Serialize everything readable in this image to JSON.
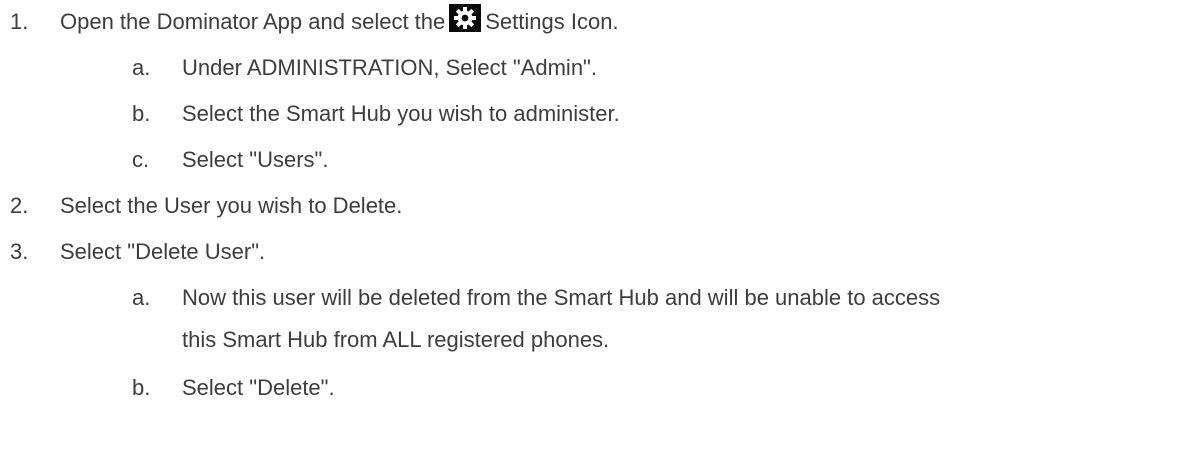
{
  "steps": [
    {
      "marker": "1.",
      "text_before": "Open the Dominator App and select the",
      "icon": "gear-icon",
      "text_after": "Settings Icon.",
      "substeps": [
        {
          "marker": "a.",
          "text": "Under ADMINISTRATION, Select \"Admin\"."
        },
        {
          "marker": "b.",
          "text": "Select the Smart Hub you wish to administer."
        },
        {
          "marker": "c.",
          "text": "Select \"Users\"."
        }
      ]
    },
    {
      "marker": "2.",
      "text": "Select the User you wish to Delete."
    },
    {
      "marker": "3.",
      "text": "Select \"Delete User\".",
      "substeps": [
        {
          "marker": "a.",
          "text_line1": "Now this user will be deleted from the Smart Hub and will be unable to access",
          "text_line2": "this Smart Hub from ALL registered phones."
        },
        {
          "marker": "b.",
          "text": "Select \"Delete\"."
        }
      ]
    }
  ],
  "colors": {
    "text": "#3d3d3d",
    "icon_background": "#0a0a0a",
    "icon_foreground": "#ffffff"
  }
}
